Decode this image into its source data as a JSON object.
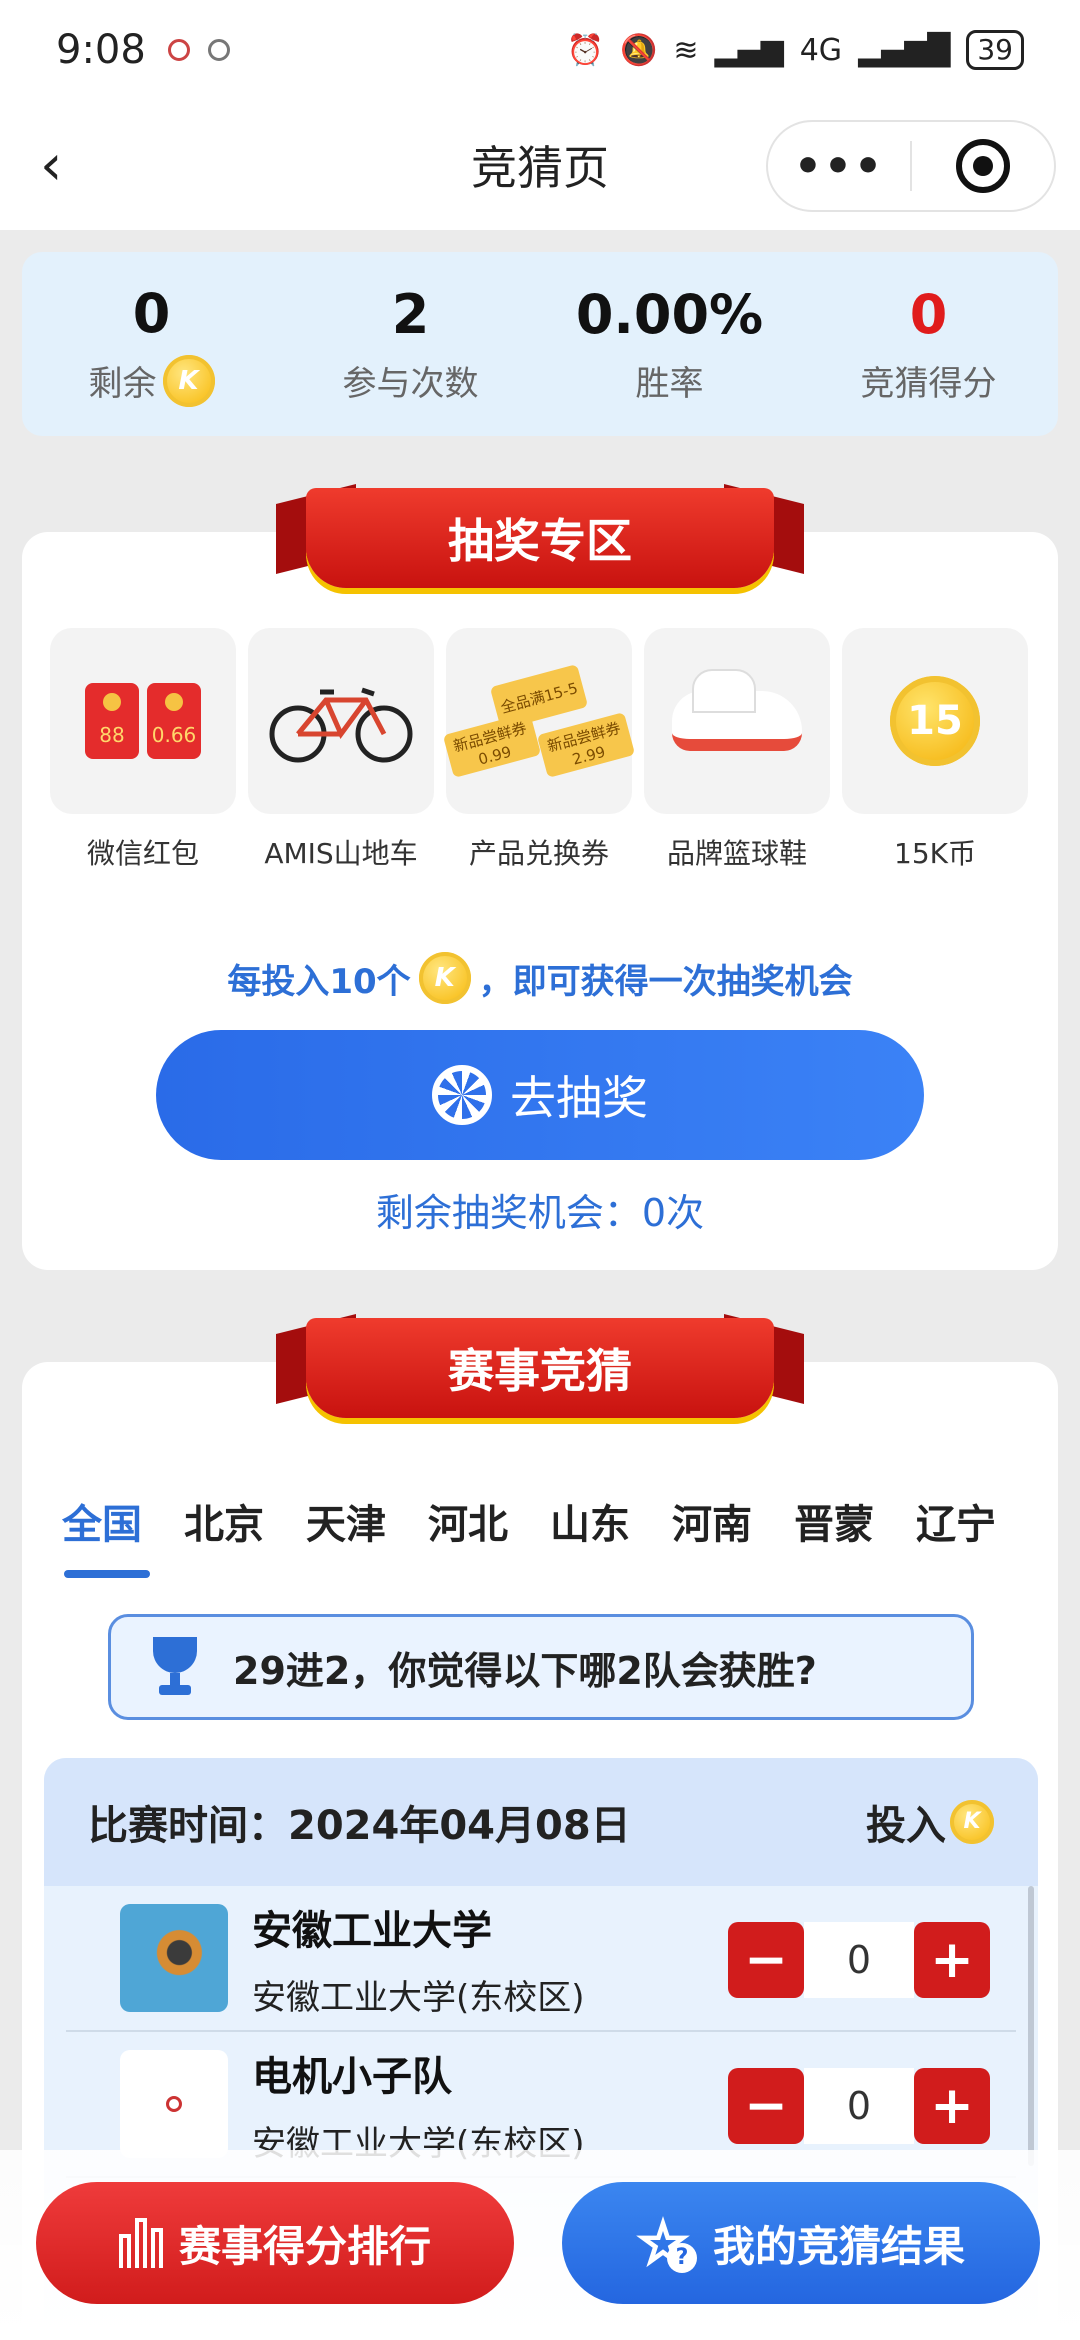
{
  "status": {
    "time": "9:08",
    "battery": "39",
    "network": "4G"
  },
  "nav": {
    "title": "竞猜页"
  },
  "stats": [
    {
      "value": "0",
      "label": "剩余",
      "coin": true
    },
    {
      "value": "2",
      "label": "参与次数"
    },
    {
      "value": "0.00%",
      "label": "胜率"
    },
    {
      "value": "0",
      "label": "竞猜得分",
      "value_color": "#e01c1c"
    }
  ],
  "lottery": {
    "title": "抽奖专区",
    "prizes": [
      {
        "label": "微信红包",
        "icon": "red-envelope-icon",
        "values": [
          "88",
          "0.66"
        ]
      },
      {
        "label": "AMIS山地车",
        "icon": "bicycle-icon"
      },
      {
        "label": "产品兑换券",
        "icon": "coupon-icon",
        "texts": [
          "全品满15-5",
          "新品尝鲜券0.99",
          "新品尝鲜券2.99"
        ]
      },
      {
        "label": "品牌篮球鞋",
        "icon": "basketball-shoe-icon"
      },
      {
        "label": "15K币",
        "icon": "coin-icon",
        "coin_value": "15"
      }
    ],
    "note_pre": "每投入10个",
    "note_post": "，即可获得一次抽奖机会",
    "draw_button": "去抽奖",
    "remaining": "剩余抽奖机会：0次"
  },
  "match": {
    "title": "赛事竞猜",
    "tabs": [
      "全国",
      "北京",
      "天津",
      "河北",
      "山东",
      "河南",
      "晋蒙",
      "辽宁"
    ],
    "active_tab": 0,
    "question": "29进2，你觉得以下哪2队会获胜?",
    "date_label": "比赛时间：2024年04月08日",
    "invest_label": "投入",
    "teams": [
      {
        "name": "安徽工业大学",
        "school": "安徽工业大学(东校区)",
        "amount": "0"
      },
      {
        "name": "电机小子队",
        "school": "安徽工业大学(东校区)",
        "amount": "0"
      }
    ]
  },
  "bottom": {
    "rank_button": "赛事得分排行",
    "result_button": "我的竞猜结果"
  },
  "colors": {
    "accent_blue": "#2d6fd6",
    "accent_red": "#d11c1c",
    "stats_bg": "#e3f1fc"
  }
}
